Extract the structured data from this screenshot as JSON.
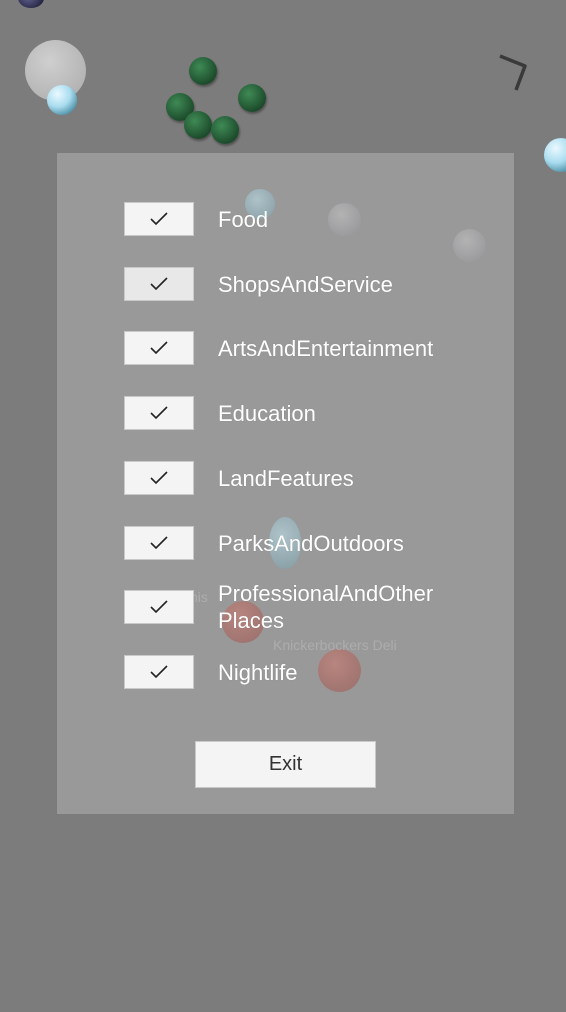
{
  "filters": [
    {
      "label": "Food",
      "checked": true,
      "icon": "check-icon"
    },
    {
      "label": "ShopsAndService",
      "checked": true,
      "icon": "check-icon"
    },
    {
      "label": "ArtsAndEntertainment",
      "checked": true,
      "icon": "check-icon"
    },
    {
      "label": "Education",
      "checked": true,
      "icon": "check-icon"
    },
    {
      "label": "LandFeatures",
      "checked": true,
      "icon": "check-icon"
    },
    {
      "label": "ParksAndOutdoors",
      "checked": true,
      "icon": "check-icon"
    },
    {
      "label": "ProfessionalAndOther\nPlaces",
      "checked": true,
      "icon": "check-icon"
    },
    {
      "label": "Nightlife",
      "checked": true,
      "icon": "check-icon"
    }
  ],
  "exit_button": {
    "label": "Exit"
  },
  "background": {
    "place_label": "Knickerbockers Deli",
    "partial_label": "nis"
  },
  "colors": {
    "scene_background": "#7c7c7c",
    "panel": "#a5a5a5",
    "checkbox": "#f4f4f4",
    "label_text": "#ffffff",
    "button_text": "#333333"
  }
}
